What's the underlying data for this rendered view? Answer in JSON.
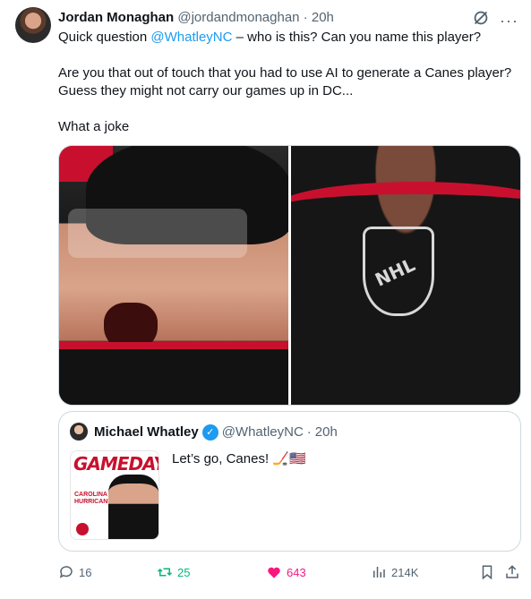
{
  "tweet": {
    "author_name": "Jordan Monaghan",
    "author_handle": "@jordandmonaghan",
    "separator": "·",
    "time": "20h",
    "text_line1_prefix": "Quick question ",
    "text_line1_mention": "@WhatleyNC",
    "text_line1_suffix": " – who is this? Can you name this player?",
    "text_para2": "Are you that out of touch that you had to use AI to generate a Canes player? Guess they might not carry our games up in DC...",
    "text_para3": "What a joke",
    "more_label": "···"
  },
  "quote": {
    "author_name": "Michael Whatley",
    "author_handle": "@WhatleyNC",
    "separator": "·",
    "time": "20h",
    "text": "Let’s go, Canes! 🏒🇺🇸",
    "thumb_title": "GAMEDAY",
    "thumb_team": "CAROLINA HURRICANES"
  },
  "actions": {
    "replies": "16",
    "retweets": "25",
    "likes": "643",
    "views": "214K"
  },
  "colors": {
    "link": "#1d9bf0",
    "retweet": "#00ba7c",
    "like": "#f91880",
    "muted": "#536471",
    "canes_red": "#c8102e"
  },
  "icons": [
    "grok-icon",
    "more-icon",
    "verified-icon",
    "reply-icon",
    "retweet-icon",
    "heart-icon",
    "views-icon",
    "bookmark-icon",
    "share-icon"
  ]
}
